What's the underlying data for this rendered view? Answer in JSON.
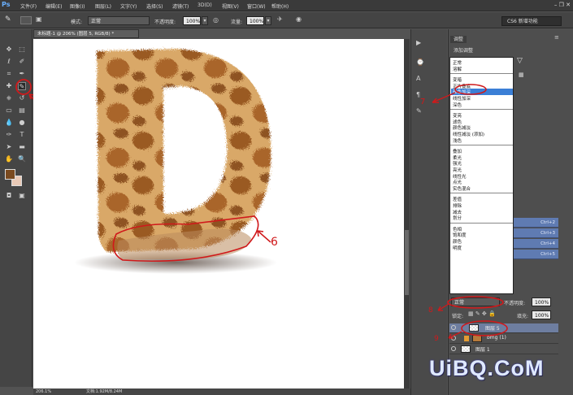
{
  "menubar": {
    "logo": "Ps",
    "items": [
      "文件(F)",
      "编辑(E)",
      "图像(I)",
      "图层(L)",
      "文字(Y)",
      "选择(S)",
      "滤镜(T)",
      "3D(D)",
      "视图(V)",
      "窗口(W)",
      "帮助(H)"
    ],
    "window_controls": "– ❐ ✕"
  },
  "options": {
    "mode_label": "模式:",
    "mode_value": "正常",
    "opacity_label": "不透明度:",
    "opacity_value": "100%",
    "flow_label": "流量:",
    "flow_value": "100%",
    "workspace": "CS6 新增功能"
  },
  "document": {
    "tab_title": "未标题-1 @ 206% (图层 5, RGB/8) *",
    "zoom": "206.1%",
    "doc_info": "文档:1.92M/8.24M"
  },
  "panel": {
    "adjust_tab": "调整",
    "add_adjust": "添加调整",
    "shortcuts": [
      "Ctrl+2",
      "Ctrl+3",
      "Ctrl+4",
      "Ctrl+5"
    ]
  },
  "blend_modes": {
    "groups": [
      [
        "正常",
        "溶解"
      ],
      [
        "变暗",
        "正片叠底",
        "颜色加深",
        "线性加深",
        "深色"
      ],
      [
        "变亮",
        "滤色",
        "颜色减淡",
        "线性减淡 (添加)",
        "浅色"
      ],
      [
        "叠加",
        "柔光",
        "强光",
        "亮光",
        "线性光",
        "点光",
        "实色混合"
      ],
      [
        "差值",
        "排除",
        "减去",
        "划分"
      ],
      [
        "色相",
        "饱和度",
        "颜色",
        "明度"
      ]
    ],
    "selected": "颜色加深"
  },
  "layers": {
    "blend_value": "正常",
    "opacity_label": "不透明度:",
    "opacity_value": "100%",
    "lock_label": "锁定:",
    "fill_label": "填充:",
    "fill_value": "100%",
    "rows": [
      "图层 5",
      "bmg (1)",
      "图层 1"
    ]
  },
  "annotations": {
    "n5": "5",
    "n6": "6",
    "n7": "7",
    "n8": "8",
    "n9": "9"
  },
  "watermark": "UiBQ.CoM",
  "colors": {
    "foreground": "#7a4a1f",
    "background": "#e9c9b6",
    "annotation": "#d0191b",
    "selection": "#3b7fd6"
  }
}
